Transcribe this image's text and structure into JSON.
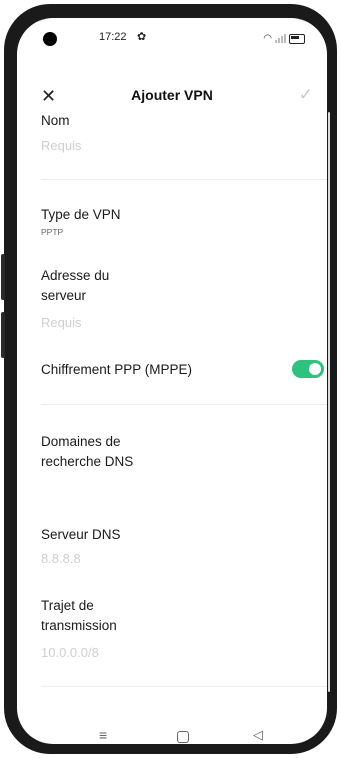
{
  "status_bar": {
    "time": "17:22",
    "settings_glyph": "✿",
    "wifi_glyph": "◠"
  },
  "header": {
    "close_glyph": "✕",
    "title": "Ajouter VPN",
    "confirm_glyph": "✓"
  },
  "form": {
    "name": {
      "label": "Nom",
      "placeholder": "Requis"
    },
    "vpn_type": {
      "label": "Type de VPN",
      "value": "PPTP"
    },
    "server_address": {
      "label_line1": "Adresse du",
      "label_line2": "serveur",
      "placeholder": "Requis"
    },
    "encryption": {
      "label": "Chiffrement PPP (MPPE)",
      "enabled": true,
      "accent_color": "#2ec27e"
    },
    "dns_domains": {
      "label_line1": "Domaines de",
      "label_line2": "recherche DNS"
    },
    "dns_server": {
      "label": "Serveur DNS",
      "placeholder": "8.8.8.8"
    },
    "forwarding_routes": {
      "label_line1": "Trajet de",
      "label_line2": "transmission",
      "placeholder": "10.0.0.0/8"
    }
  },
  "nav_bar": {
    "menu_glyph": "≡",
    "back_glyph": "◁"
  }
}
